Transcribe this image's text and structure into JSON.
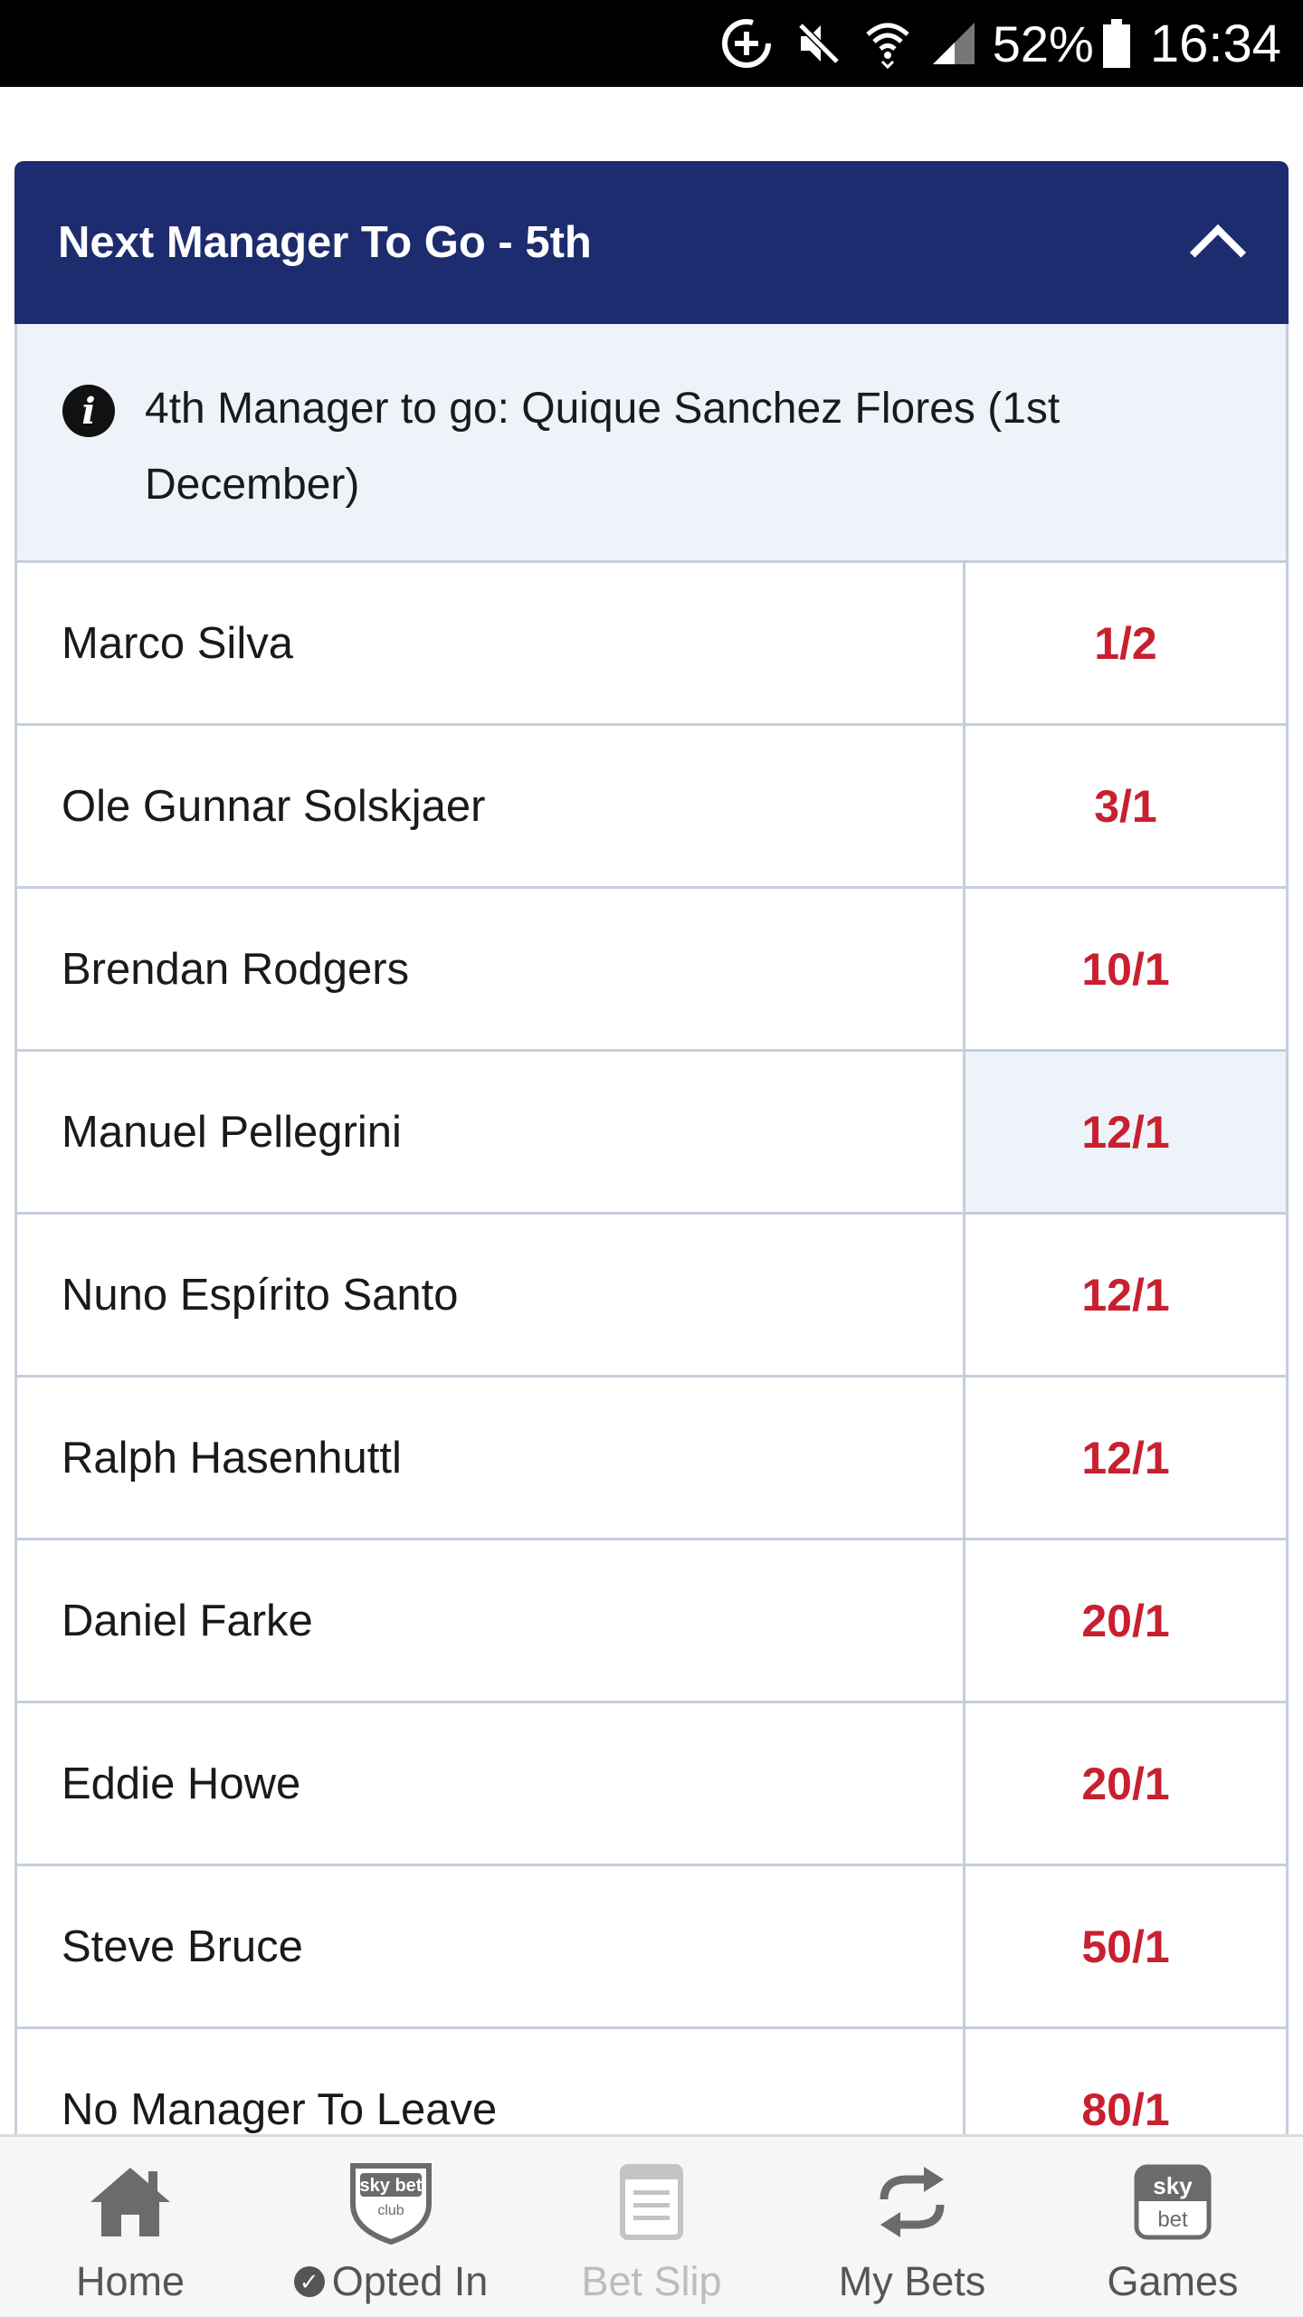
{
  "status_bar": {
    "icons": [
      "data-saver-icon",
      "mute-icon",
      "wifi-icon",
      "signal-icon"
    ],
    "battery": "52%",
    "time": "16:34"
  },
  "market": {
    "title": "Next Manager To Go - 5th",
    "collapse_icon": "chevron-up-icon",
    "info_icon": "info-icon",
    "info_text": "4th Manager to go: Quique Sanchez Flores (1st December)",
    "selections": [
      {
        "name": "Marco Silva",
        "price": "1/2"
      },
      {
        "name": "Ole Gunnar Solskjaer",
        "price": "3/1"
      },
      {
        "name": "Brendan Rodgers",
        "price": "10/1"
      },
      {
        "name": "Manuel Pellegrini",
        "price": "12/1"
      },
      {
        "name": "Nuno Espírito Santo",
        "price": "12/1"
      },
      {
        "name": "Ralph Hasenhuttl",
        "price": "12/1"
      },
      {
        "name": "Daniel Farke",
        "price": "20/1"
      },
      {
        "name": "Eddie Howe",
        "price": "20/1"
      },
      {
        "name": "Steve Bruce",
        "price": "50/1"
      },
      {
        "name": "No Manager To Leave",
        "price": "80/1"
      }
    ]
  },
  "bottom_nav": {
    "items": [
      {
        "label": "Home",
        "icon": "home-icon"
      },
      {
        "label": "Opted In",
        "icon": "skybet-club-shield-icon",
        "logo_text": [
          "sky bet",
          "club"
        ]
      },
      {
        "label": "Bet Slip",
        "icon": "bet-slip-icon"
      },
      {
        "label": "My Bets",
        "icon": "my-bets-refresh-icon"
      },
      {
        "label": "Games",
        "icon": "skybet-games-icon",
        "logo_text": [
          "sky",
          "bet"
        ]
      }
    ]
  },
  "colors": {
    "header_bg": "#1c2c6e",
    "price_text": "#c8202f",
    "info_bg": "#eef3fa",
    "border": "#c6cedd"
  }
}
